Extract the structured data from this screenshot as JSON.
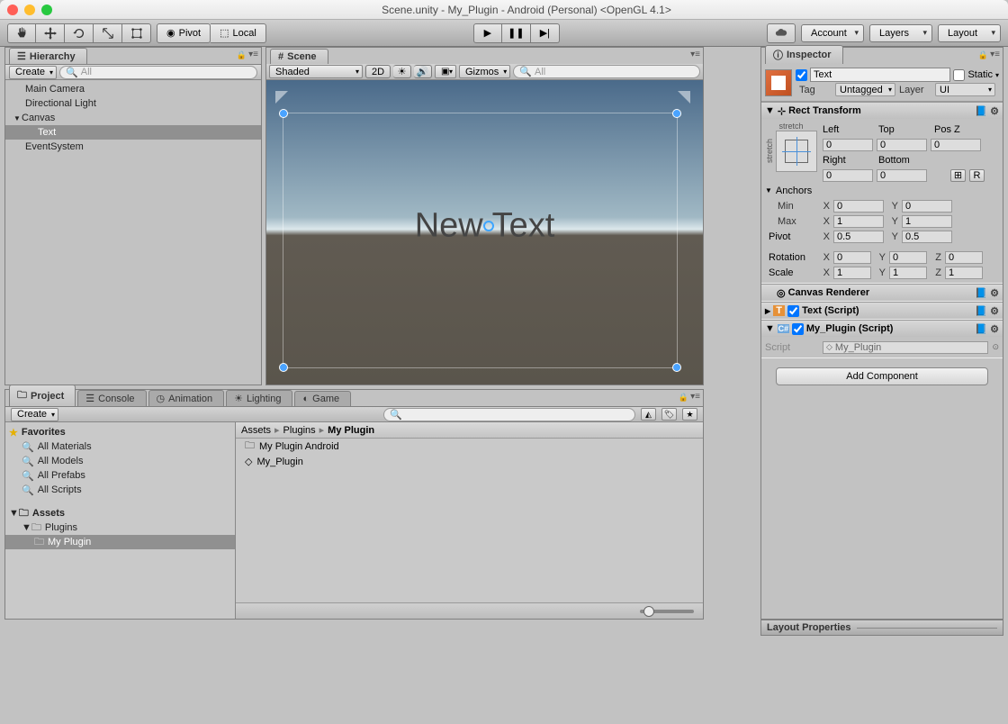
{
  "window": {
    "title": "Scene.unity - My_Plugin - Android (Personal) <OpenGL 4.1>"
  },
  "toolbar": {
    "pivot": "Pivot",
    "local": "Local",
    "account": "Account",
    "layers": "Layers",
    "layout": "Layout"
  },
  "hierarchy": {
    "tab": "Hierarchy",
    "create": "Create",
    "search_placeholder": "All",
    "items": [
      {
        "label": "Main Camera",
        "indent": 1
      },
      {
        "label": "Directional Light",
        "indent": 1
      },
      {
        "label": "Canvas",
        "indent": 0,
        "fold": "▼"
      },
      {
        "label": "Text",
        "indent": 2,
        "selected": true
      },
      {
        "label": "EventSystem",
        "indent": 1
      }
    ]
  },
  "scene": {
    "tab": "Scene",
    "shaded": "Shaded",
    "mode2d": "2D",
    "gizmos": "Gizmos",
    "search_placeholder": "All",
    "content_text": "New Text"
  },
  "inspector": {
    "tab": "Inspector",
    "object_name": "Text",
    "static": "Static",
    "tag_label": "Tag",
    "tag_value": "Untagged",
    "layer_label": "Layer",
    "layer_value": "UI",
    "rect_transform": {
      "title": "Rect Transform",
      "stretch_v": "stretch",
      "stretch_h": "stretch",
      "left_label": "Left",
      "left": "0",
      "top_label": "Top",
      "top": "0",
      "posz_label": "Pos Z",
      "posz": "0",
      "right_label": "Right",
      "right": "0",
      "bottom_label": "Bottom",
      "bottom": "0",
      "anchors_label": "Anchors",
      "min_label": "Min",
      "min_x": "0",
      "min_y": "0",
      "max_label": "Max",
      "max_x": "1",
      "max_y": "1",
      "pivot_label": "Pivot",
      "pivot_x": "0.5",
      "pivot_y": "0.5",
      "rotation_label": "Rotation",
      "rot_x": "0",
      "rot_y": "0",
      "rot_z": "0",
      "scale_label": "Scale",
      "scale_x": "1",
      "scale_y": "1",
      "scale_z": "1",
      "blueprint_btn": "⊞",
      "raw_btn": "R"
    },
    "canvas_renderer": {
      "title": "Canvas Renderer"
    },
    "text_script": {
      "title": "Text (Script)"
    },
    "my_plugin": {
      "title": "My_Plugin (Script)",
      "script_label": "Script",
      "script_value": "My_Plugin"
    },
    "add_component": "Add Component",
    "layout_properties": "Layout Properties"
  },
  "project": {
    "tabs": [
      "Project",
      "Console",
      "Animation",
      "Lighting",
      "Game"
    ],
    "create": "Create",
    "favorites_label": "Favorites",
    "favorites": [
      "All Materials",
      "All Models",
      "All Prefabs",
      "All Scripts"
    ],
    "assets_label": "Assets",
    "plugins_label": "Plugins",
    "myplugin_label": "My Plugin",
    "breadcrumb": [
      "Assets",
      "Plugins",
      "My Plugin"
    ],
    "items": [
      {
        "label": "My Plugin Android",
        "icon": "folder"
      },
      {
        "label": "My_Plugin",
        "icon": "script"
      }
    ]
  }
}
